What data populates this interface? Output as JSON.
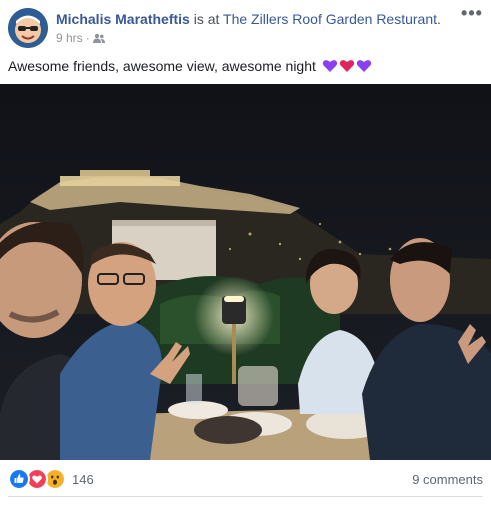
{
  "post": {
    "author": "Michalis Maratheftis",
    "checkin_text": " is at ",
    "place": "The Zillers Roof Garden Resturant",
    "place_suffix": ".",
    "time": "9 hrs",
    "dot": "·",
    "audience_icon": "friends-icon",
    "more_label": "•••",
    "caption": "Awesome friends, awesome view, awesome night",
    "caption_emojis": [
      "purple-heart",
      "red-heart",
      "purple-heart"
    ],
    "photo": {
      "description_icon": "photo"
    }
  },
  "footer": {
    "reaction_icons": [
      "like-icon",
      "love-icon",
      "wow-icon"
    ],
    "reaction_count": "146",
    "comments": "9 comments"
  },
  "colors": {
    "link": "#385898",
    "meta": "#90949c",
    "like": "#1877f2",
    "love": "#f33e58",
    "wow": "#f7b125",
    "purple_heart": "#8a3ff0"
  }
}
